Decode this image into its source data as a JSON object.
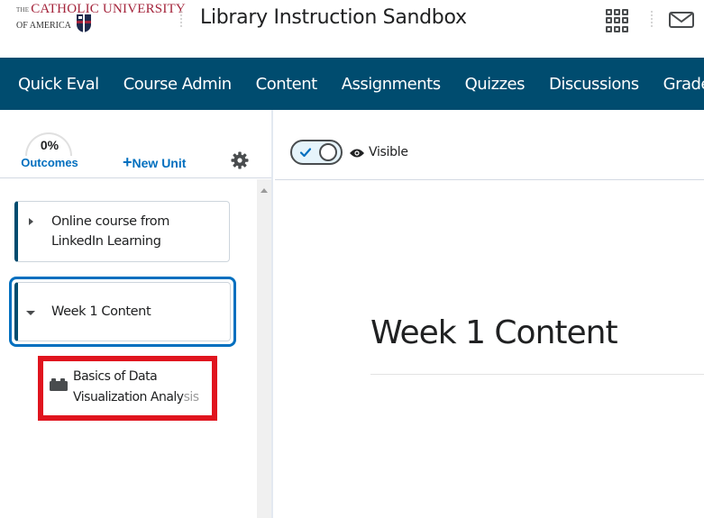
{
  "header": {
    "logo_line1_prefix": "THE",
    "logo_line1": "CATHOLIC UNIVERSITY",
    "logo_line2": "OF AMERICA",
    "course_title": "Library Instruction Sandbox",
    "icons": [
      "apps-grid-icon",
      "mail-icon"
    ]
  },
  "navbar": {
    "items": [
      "Quick Eval",
      "Course Admin",
      "Content",
      "Assignments",
      "Quizzes",
      "Discussions",
      "Grades"
    ],
    "background": "#004c6f"
  },
  "sidebar": {
    "outcomes": {
      "percent": "0%",
      "label": "Outcomes"
    },
    "new_unit": {
      "plus": "+",
      "label": "New Unit"
    },
    "units": [
      {
        "title": "Online course from LinkedIn Learning",
        "expanded": false
      },
      {
        "title": "Week 1 Content",
        "expanded": true,
        "focused": true
      }
    ],
    "topics": [
      {
        "title_line1": "Basics of Data",
        "title_line2_main": "Visualization Analy",
        "title_line2_fade": "sis",
        "icon": "lego-block-icon",
        "highlighted": true
      }
    ]
  },
  "main": {
    "visibility": {
      "on": true,
      "label": "Visible"
    },
    "unit_title": "Week 1 Content"
  },
  "colors": {
    "accent": "#006fbf",
    "nav_bg": "#004c6f",
    "highlight_box": "#e0141e",
    "brand_red": "#a4243b"
  }
}
